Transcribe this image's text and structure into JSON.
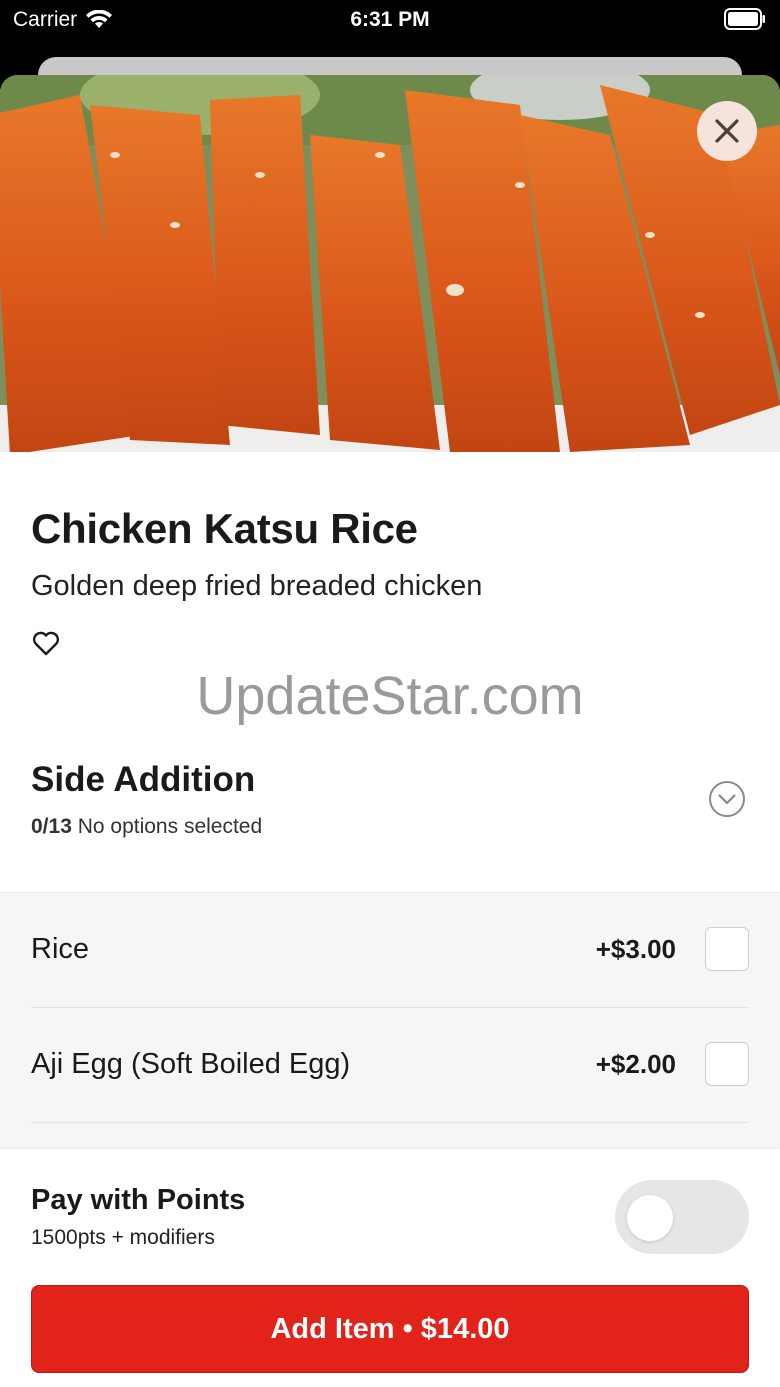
{
  "status_bar": {
    "carrier": "Carrier",
    "time": "6:31 PM"
  },
  "item": {
    "title": "Chicken Katsu Rice",
    "description": "Golden deep fried breaded chicken"
  },
  "watermark": "UpdateStar.com",
  "side_addition": {
    "title": "Side Addition",
    "count": "0/13",
    "status": "No options selected",
    "options": [
      {
        "name": "Rice",
        "price": "+$3.00"
      },
      {
        "name": "Aji Egg (Soft Boiled Egg)",
        "price": "+$2.00"
      }
    ]
  },
  "points": {
    "title": "Pay with Points",
    "subtitle": "1500pts + modifiers"
  },
  "add_button": {
    "label": "Add Item • $14.00"
  },
  "colors": {
    "accent": "#e2231a",
    "close_bg": "#f6e4dc"
  },
  "icons": [
    "wifi-icon",
    "battery-icon",
    "close-icon",
    "heart-icon",
    "chevron-down-icon"
  ]
}
